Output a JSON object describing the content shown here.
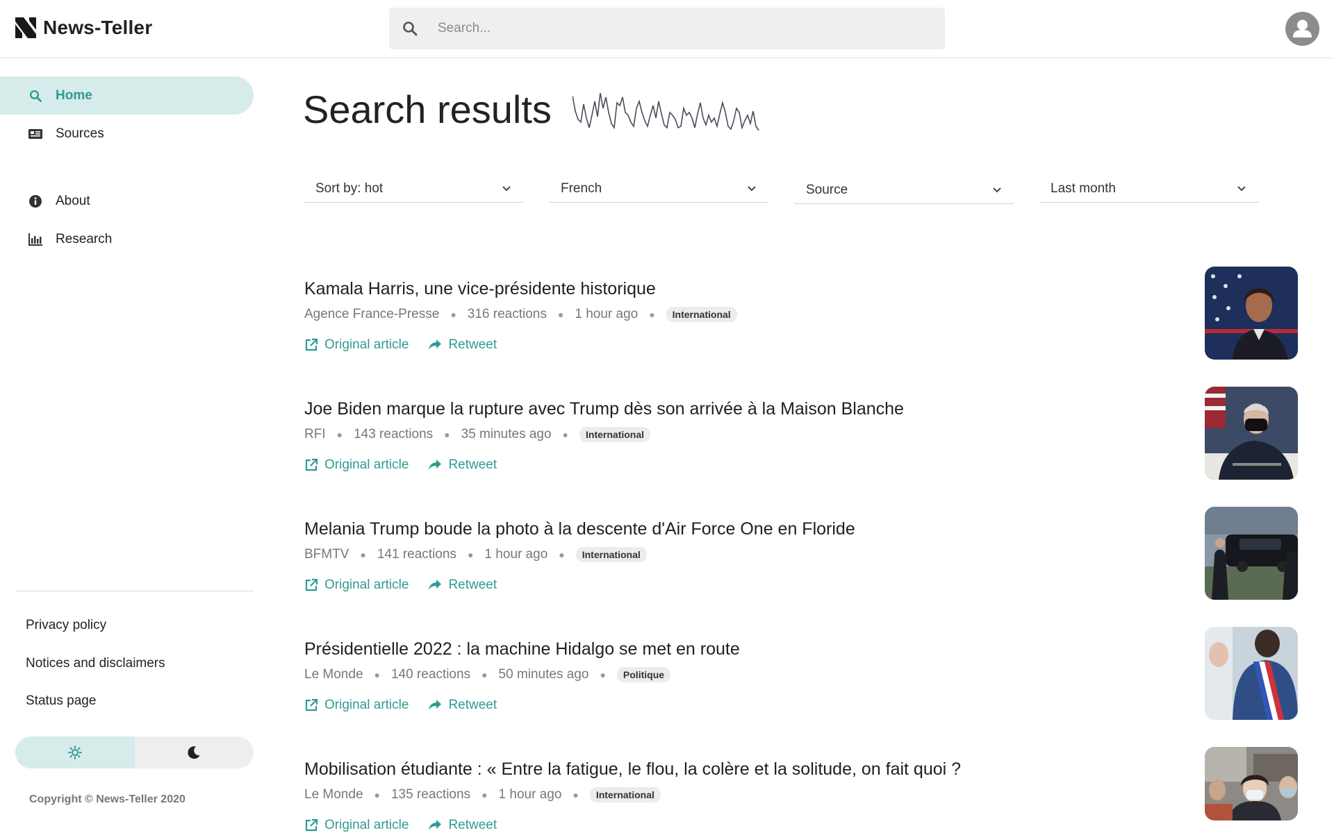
{
  "app": {
    "name": "News-Teller"
  },
  "search": {
    "placeholder": "Search..."
  },
  "sidebar": {
    "items": [
      {
        "label": "Home",
        "icon": "search-icon",
        "active": true
      },
      {
        "label": "Sources",
        "icon": "newspaper-icon"
      },
      {
        "label": "About",
        "icon": "info-icon"
      },
      {
        "label": "Research",
        "icon": "bar-chart-icon"
      }
    ],
    "footer_links": [
      "Privacy policy",
      "Notices and disclaimers",
      "Status page"
    ],
    "theme": {
      "light_icon": "sun-icon",
      "dark_icon": "moon-icon",
      "selected": "light"
    },
    "copyright": "Copyright © News-Teller 2020"
  },
  "main": {
    "title": "Search results",
    "filters": [
      {
        "value": "Sort by: hot"
      },
      {
        "value": "French"
      },
      {
        "value": "Source"
      },
      {
        "value": "Last month"
      }
    ],
    "action_labels": {
      "original": "Original article",
      "retweet": "Retweet"
    },
    "articles": [
      {
        "title": "Kamala Harris, une vice-présidente historique",
        "source": "Agence France-Presse",
        "reactions": "316 reactions",
        "time": "1 hour ago",
        "tag": "International"
      },
      {
        "title": "Joe Biden marque la rupture avec Trump dès son arrivée à la Maison Blanche",
        "source": "RFI",
        "reactions": "143 reactions",
        "time": "35 minutes ago",
        "tag": "International"
      },
      {
        "title": "Melania Trump boude la photo à la descente d'Air Force One en Floride",
        "source": "BFMTV",
        "reactions": "141 reactions",
        "time": "1 hour ago",
        "tag": "International"
      },
      {
        "title": "Présidentielle 2022 : la machine Hidalgo se met en route",
        "source": "Le Monde",
        "reactions": "140 reactions",
        "time": "50 minutes ago",
        "tag": "Politique"
      },
      {
        "title": "Mobilisation étudiante : « Entre la fatigue, le flou, la colère et la solitude, on fait quoi ?",
        "source": "Le Monde",
        "reactions": "135 reactions",
        "time": "1 hour ago",
        "tag": "International"
      }
    ]
  },
  "colors": {
    "accent": "#2f9b92",
    "accent_bg": "#d6ecea",
    "search_bg": "#efefef"
  }
}
